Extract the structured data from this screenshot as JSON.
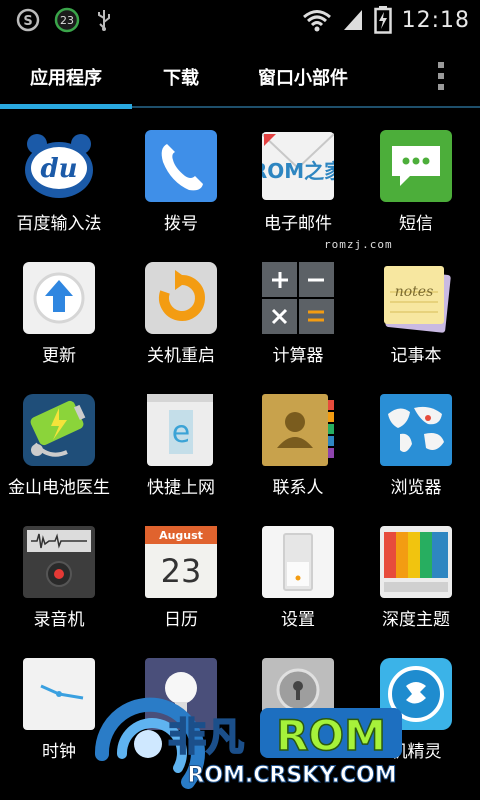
{
  "status_bar": {
    "time": "12:18",
    "notification_count": "23"
  },
  "tabs": [
    {
      "label": "应用程序",
      "active": true
    },
    {
      "label": "下载",
      "active": false
    },
    {
      "label": "窗口小部件",
      "active": false
    }
  ],
  "apps": [
    {
      "label": "百度输入法",
      "icon": "baidu-input-icon"
    },
    {
      "label": "拨号",
      "icon": "phone-icon"
    },
    {
      "label": "电子邮件",
      "icon": "email-icon",
      "icon_text": "ROM之家"
    },
    {
      "label": "短信",
      "icon": "sms-icon"
    },
    {
      "label": "更新",
      "icon": "update-icon"
    },
    {
      "label": "关机重启",
      "icon": "reboot-icon"
    },
    {
      "label": "计算器",
      "icon": "calculator-icon"
    },
    {
      "label": "记事本",
      "icon": "notepad-icon",
      "icon_text": "notes"
    },
    {
      "label": "金山电池医生",
      "icon": "battery-doctor-icon"
    },
    {
      "label": "快捷上网",
      "icon": "browser-e-icon"
    },
    {
      "label": "联系人",
      "icon": "contacts-icon"
    },
    {
      "label": "浏览器",
      "icon": "globe-icon"
    },
    {
      "label": "录音机",
      "icon": "recorder-icon"
    },
    {
      "label": "日历",
      "icon": "calendar-icon",
      "icon_month": "August",
      "icon_day": "23"
    },
    {
      "label": "设置",
      "icon": "settings-switch-icon"
    },
    {
      "label": "深度主题",
      "icon": "theme-icon"
    },
    {
      "label": "时钟",
      "icon": "clock-icon"
    },
    {
      "label": "",
      "icon": "light-icon"
    },
    {
      "label": "",
      "icon": "lock-icon"
    },
    {
      "label": "机精灵",
      "icon": "shield-app-icon"
    }
  ],
  "overlay_text": {
    "romzj": "romzj.com",
    "brand_cn": "非凡",
    "brand_rom": "ROM",
    "brand_url": "ROM.CRSKY.COM"
  },
  "colors": {
    "accent": "#2aa9e0",
    "background": "#000000"
  }
}
